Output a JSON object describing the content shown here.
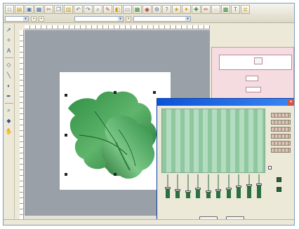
{
  "toolbar": {
    "buttons": [
      "new-icon",
      "open-icon",
      "save-icon",
      "print-icon",
      "cut-icon",
      "copy-icon",
      "paste-icon",
      "undo-icon",
      "redo-icon",
      "zoom-icon",
      "pen-icon",
      "fill-icon",
      "select-icon",
      "grid-icon",
      "color-icon",
      "settings-icon",
      "help-icon",
      "star-icon",
      "wand-icon",
      "stitch-icon",
      "pencil-icon",
      "eraser-icon",
      "image-icon",
      "text-icon",
      "layers-icon"
    ],
    "combos": [
      {
        "value": ""
      },
      {
        "value": ""
      },
      {
        "value": ""
      }
    ]
  },
  "tools": [
    "pointer-icon",
    "lasso-icon",
    "text-tool-icon",
    "shape-icon",
    "line-icon",
    "fill-tool-icon",
    "eyedropper-icon",
    "zoom-tool-icon",
    "node-icon",
    "hand-icon"
  ],
  "sidepanel": {
    "title": "",
    "labels": [
      "",
      "",
      ""
    ]
  },
  "dialog": {
    "title": "",
    "swatch_label": "",
    "checkbox_label": "",
    "slider_labels": [
      "",
      "",
      "",
      "",
      "",
      "",
      "",
      "",
      "",
      ""
    ],
    "slider_levels": [
      0.45,
      0.35,
      0.3,
      0.4,
      0.3,
      0.35,
      0.4,
      0.5,
      0.55,
      0.6
    ],
    "buttons": {
      "ok": "",
      "cancel": ""
    }
  },
  "status": {
    "left": "",
    "middle": ""
  },
  "colors": {
    "accent": "#0a53d8",
    "leaf_dark": "#1f7a35",
    "leaf_light": "#6cc07a",
    "panel_pink": "#f5dce1"
  }
}
